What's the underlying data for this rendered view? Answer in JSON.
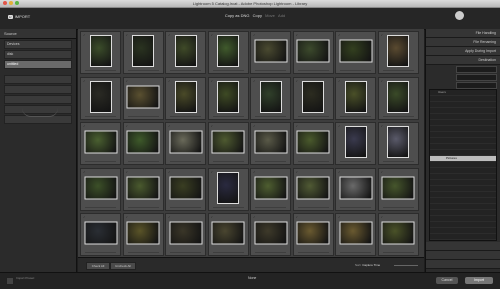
{
  "window": {
    "title": "Lightroom 5 Catalog.lrcat - Adobe Photoshop Lightroom - Library"
  },
  "header": {
    "app_name": "IMPORT",
    "badge": "Lr",
    "options": [
      "Copy as DNG",
      "Copy",
      "Move",
      "Add"
    ],
    "selected_option": 1
  },
  "left_panel": {
    "title": "Source",
    "rows": [
      "Devices",
      "disk",
      "untitled"
    ],
    "selected_row": 2,
    "sub_rows": [
      "",
      "",
      "",
      "",
      ""
    ]
  },
  "right_panel": {
    "sections": [
      "File Handling",
      "File Renaming",
      "Apply During Import",
      "Destination"
    ],
    "fields": [
      "",
      "",
      "",
      ""
    ],
    "bottom_sections": [
      "",
      "",
      "",
      "",
      ""
    ]
  },
  "grid": {
    "columns": 8,
    "rows": 5,
    "photos": [
      {
        "o": "p",
        "c": "#3b4d2a"
      },
      {
        "o": "p",
        "c": "#2a3320"
      },
      {
        "o": "p",
        "c": "#3f4a28"
      },
      {
        "o": "p",
        "c": "#405a2c"
      },
      {
        "o": "l",
        "c": "#4a4a30"
      },
      {
        "o": "l",
        "c": "#3c4a2c"
      },
      {
        "o": "l",
        "c": "#33401f"
      },
      {
        "o": "p",
        "c": "#5a4a30"
      },
      {
        "o": "p",
        "c": "#2a2a24"
      },
      {
        "o": "l",
        "c": "#5a5030"
      },
      {
        "o": "p",
        "c": "#4a4a28"
      },
      {
        "o": "p",
        "c": "#3e4a24"
      },
      {
        "o": "p",
        "c": "#30402a"
      },
      {
        "o": "p",
        "c": "#2c2c20"
      },
      {
        "o": "p",
        "c": "#4a5028"
      },
      {
        "o": "p",
        "c": "#3a4a28"
      },
      {
        "o": "l",
        "c": "#4a6030"
      },
      {
        "o": "l",
        "c": "#3e5a2a"
      },
      {
        "o": "l",
        "c": "#6a6a5a"
      },
      {
        "o": "l",
        "c": "#4e5a30"
      },
      {
        "o": "l",
        "c": "#5a5a48"
      },
      {
        "o": "l",
        "c": "#4a5a2c"
      },
      {
        "o": "p",
        "c": "#3a3a4e"
      },
      {
        "o": "p",
        "c": "#5a5a6a"
      },
      {
        "o": "l",
        "c": "#3c5028"
      },
      {
        "o": "l",
        "c": "#4a5a2e"
      },
      {
        "o": "l",
        "c": "#3a3e22"
      },
      {
        "o": "p",
        "c": "#2a2a40"
      },
      {
        "o": "l",
        "c": "#4e5e30"
      },
      {
        "o": "l",
        "c": "#505a34"
      },
      {
        "o": "l",
        "c": "#6a6a6a"
      },
      {
        "o": "l",
        "c": "#46562c"
      },
      {
        "o": "l",
        "c": "#2a2e34"
      },
      {
        "o": "l",
        "c": "#5a5428"
      },
      {
        "o": "l",
        "c": "#3a3628"
      },
      {
        "o": "l",
        "c": "#4a4630"
      },
      {
        "o": "l",
        "c": "#3e3a2a"
      },
      {
        "o": "l",
        "c": "#6a5a30"
      },
      {
        "o": "l",
        "c": "#6a5a30"
      },
      {
        "o": "l",
        "c": "#4a5228"
      }
    ]
  },
  "toolbar": {
    "check_all": "Check All",
    "uncheck_all": "Uncheck All",
    "sort_label": "Sort:",
    "sort_value": "Capture Time"
  },
  "footer": {
    "import_preset": "Import Preset:",
    "preset_value": "None",
    "cancel": "Cancel",
    "import": "Import"
  },
  "folders": [
    "Users",
    "",
    "",
    "",
    "",
    "",
    "",
    "",
    "",
    "",
    "",
    "Pictures",
    "",
    "",
    "",
    "",
    "",
    "",
    "",
    "",
    "",
    "",
    "",
    "",
    "",
    "",
    "",
    "",
    "",
    "",
    "",
    ""
  ],
  "folder_selected": 11
}
